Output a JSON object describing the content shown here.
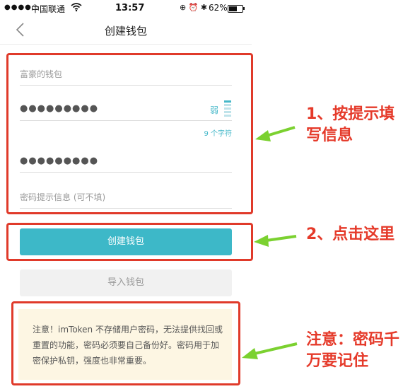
{
  "status_bar": {
    "signal": "●●●●○",
    "carrier": "中国联通",
    "wifi_icon": "wifi-icon",
    "time": "13:57",
    "icons": "⊕ ⏰ ✱",
    "battery_pct": "62%",
    "battery_level": 0.62
  },
  "nav": {
    "title": "创建钱包"
  },
  "form": {
    "wallet_name_placeholder": "富豪的钱包",
    "password_dots": "●●●●●●●●●",
    "strength_label": "弱",
    "char_count": "9 个字符",
    "confirm_dots": "●●●●●●●●●",
    "hint_placeholder": "密码提示信息 (可不填)"
  },
  "buttons": {
    "create": "创建钱包",
    "import": "导入钱包"
  },
  "notice": {
    "text": "注意！imToken 不存储用户密码，无法提供找回或重置的功能，密码必须要自己备份好。密码用于加密保护私钥，强度也非常重要。"
  },
  "annotations": {
    "step1_line1": "1、按提示填",
    "step1_line2": "写信息",
    "step2": "2、点击这里",
    "note_line1": "注意：密码千",
    "note_line2": "万要记住"
  },
  "colors": {
    "accent": "#3db8c8",
    "highlight_red": "#e03a2a",
    "arrow_green": "#7bd130",
    "notice_bg": "#fdf6e3"
  }
}
